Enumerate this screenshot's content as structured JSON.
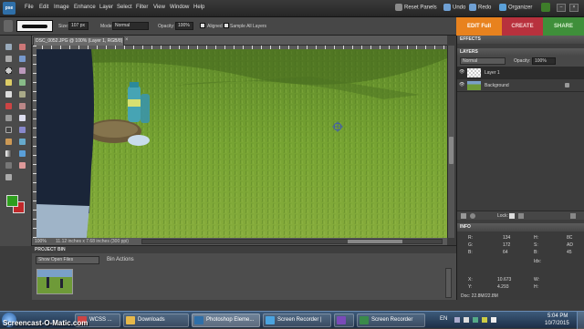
{
  "menubar": {
    "logo": "pse",
    "items": [
      "File",
      "Edit",
      "Image",
      "Enhance",
      "Layer",
      "Select",
      "Filter",
      "View",
      "Window",
      "Help"
    ],
    "reset_panels": "Reset Panels",
    "undo": "Undo",
    "redo": "Redo",
    "organizer": "Organizer"
  },
  "options": {
    "size_label": "Size:",
    "size_value": "107 px",
    "mode_label": "Mode:",
    "mode_value": "Normal",
    "opacity_label": "Opacity:",
    "opacity_value": "100%",
    "aligned": "Aligned",
    "sample_all_layers": "Sample All Layers"
  },
  "mode_tabs": {
    "edit": "EDIT Full",
    "create": "CREATE",
    "share": "SHARE"
  },
  "document": {
    "tab_title": "DSC_0052.JPG @ 100% (Layer 1, RGB/8) *",
    "zoom": "100%",
    "doc_size": "11.12 inches x 7.68 inches (300 ppi)"
  },
  "project_bin": {
    "title": "PROJECT BIN",
    "dropdown": "Show Open Files",
    "bin_actions": "Bin Actions"
  },
  "panels": {
    "effects": "EFFECTS",
    "layers": "LAYERS",
    "blend_mode": "Normal",
    "opacity_label": "Opacity:",
    "opacity_value": "100%",
    "layer_items": [
      {
        "name": "Layer 1"
      },
      {
        "name": "Background"
      }
    ],
    "lock_label": "Lock:",
    "info": "INFO",
    "info_rgb": {
      "r_label": "R:",
      "r": "134",
      "g_label": "G:",
      "g": "172",
      "b_label": "B:",
      "b": "64"
    },
    "info_hsb": {
      "h_label": "H:",
      "h": "8C",
      "s_label": "S:",
      "s": "AD",
      "b_label": "B:",
      "b": "45"
    },
    "idx_label": "Idx:",
    "x_label": "X:",
    "x": "10.673",
    "y_label": "Y:",
    "y": "4.293",
    "w_label": "W:",
    "h_label": "H:",
    "doc_label": "Doc: 22.8M/22.8M"
  },
  "taskbar": {
    "watermark": "Screencast-O-Matic.com",
    "tasks": [
      "WCSS ...",
      "Downloads",
      "Photoshop Eleme...",
      "Screen Recorder |",
      "",
      "Screen Recorder"
    ],
    "lang": "EN",
    "time": "5:04 PM",
    "date": "10/7/2015"
  },
  "colors": {
    "edit_tab": "#e8821e",
    "create_tab": "#b8313d",
    "share_tab": "#3f8f3a",
    "foreground": "#2e9e1e",
    "background": "#c0282a"
  }
}
